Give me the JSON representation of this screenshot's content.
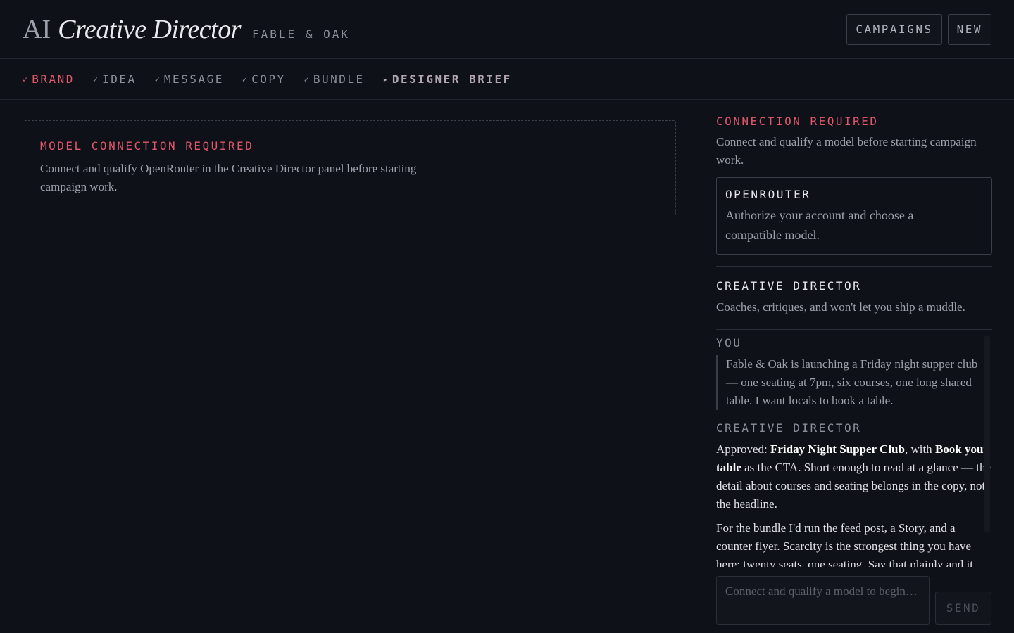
{
  "header": {
    "ai": "AI",
    "title": "Creative Director",
    "client": "FABLE & OAK",
    "buttons": {
      "campaigns": "CAMPAIGNS",
      "new": "NEW"
    }
  },
  "steps": [
    {
      "mark": "✓",
      "label": "BRAND",
      "state": "active"
    },
    {
      "mark": "✓",
      "label": "IDEA",
      "state": "done"
    },
    {
      "mark": "✓",
      "label": "MESSAGE",
      "state": "done"
    },
    {
      "mark": "✓",
      "label": "COPY",
      "state": "done"
    },
    {
      "mark": "✓",
      "label": "BUNDLE",
      "state": "done"
    },
    {
      "mark": "▸",
      "label": "DESIGNER BRIEF",
      "state": "current"
    }
  ],
  "main": {
    "notice_title": "MODEL CONNECTION REQUIRED",
    "notice_text": "Connect and qualify OpenRouter in the Creative Director panel before starting campaign work."
  },
  "sidebar": {
    "connection_title": "CONNECTION REQUIRED",
    "connection_text": "Connect and qualify a model before starting campaign work.",
    "provider": {
      "name": "OPENROUTER",
      "description": "Authorize your account and choose a compatible model."
    },
    "director_title": "CREATIVE DIRECTOR",
    "director_desc": "Coaches, critiques, and won't let you ship a muddle.",
    "chat": {
      "you_label": "YOU",
      "you_text": "Fable & Oak is launching a Friday night supper club — one seating at 7pm, six courses, one long shared table. I want locals to book a table.",
      "cd_label": "CREATIVE DIRECTOR",
      "cd_p1_a": "Approved: ",
      "cd_p1_b": "Friday Night Supper Club",
      "cd_p1_c": ", with ",
      "cd_p1_d": "Book your table",
      "cd_p1_e": " as the CTA. Short enough to read at a glance — the detail about courses and seating belongs in the copy, not the headline.",
      "cd_p2": "For the bundle I'd run the feed post, a Story, and a counter flyer. Scarcity is the strongest thing you have here: twenty seats, one seating. Say that plainly and it"
    },
    "composer": {
      "placeholder": "Connect and qualify a model to begin…",
      "send": "SEND"
    }
  },
  "colors": {
    "background": "#0e1118",
    "accent": "#e0566a",
    "border": "#3a3e48"
  }
}
